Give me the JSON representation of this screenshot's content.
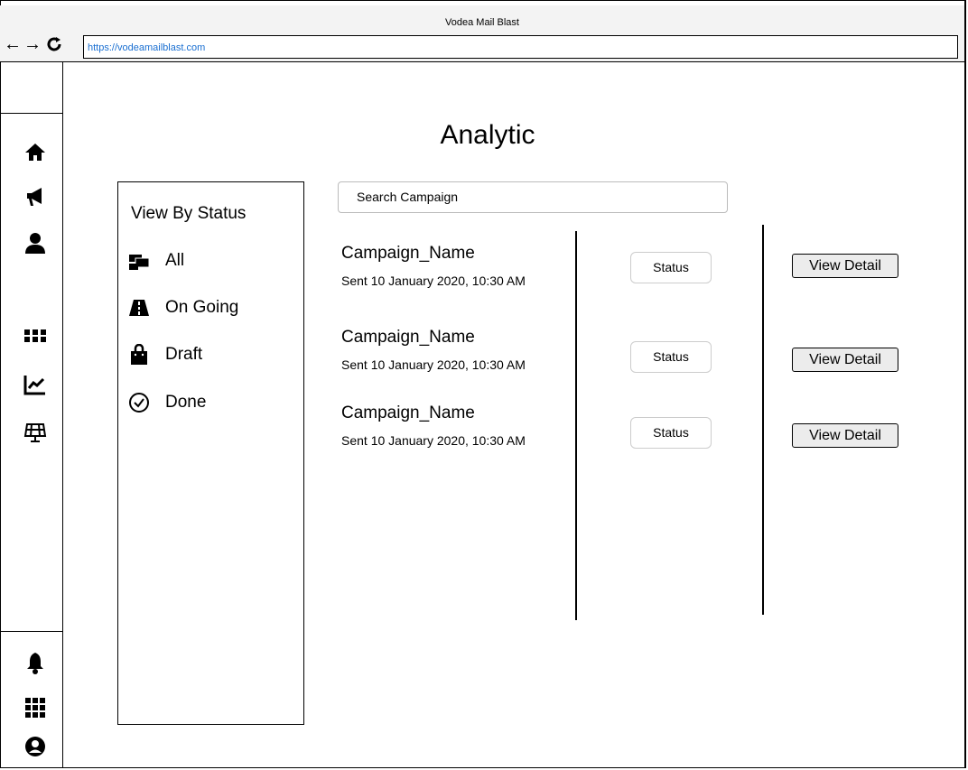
{
  "window": {
    "title": "Vodea Mail Blast"
  },
  "browser": {
    "url": "https://vodeamailblast.com"
  },
  "sidebar": {
    "icons": [
      "home-icon",
      "megaphone-icon",
      "user-icon",
      "grid-icon",
      "chart-line-icon",
      "solar-panel-icon",
      "bell-icon",
      "apps-icon",
      "account-circle-icon"
    ]
  },
  "page": {
    "title": "Analytic"
  },
  "status_panel": {
    "title": "View By Status",
    "filters": [
      {
        "label": "All",
        "icon": "mail-bulk-icon"
      },
      {
        "label": "On Going",
        "icon": "road-icon"
      },
      {
        "label": "Draft",
        "icon": "shopping-bag-icon"
      },
      {
        "label": "Done",
        "icon": "check-circle-icon"
      }
    ]
  },
  "search": {
    "placeholder": "Search Campaign"
  },
  "campaigns": [
    {
      "name": "Campaign_Name",
      "sent": "Sent 10 January 2020, 10:30 AM",
      "status": "Status",
      "action": "View Detail"
    },
    {
      "name": "Campaign_Name",
      "sent": "Sent 10 January 2020, 10:30 AM",
      "status": "Status",
      "action": "View Detail"
    },
    {
      "name": "Campaign_Name",
      "sent": "Sent 10 January 2020, 10:30 AM",
      "status": "Status",
      "action": "View Detail"
    }
  ]
}
